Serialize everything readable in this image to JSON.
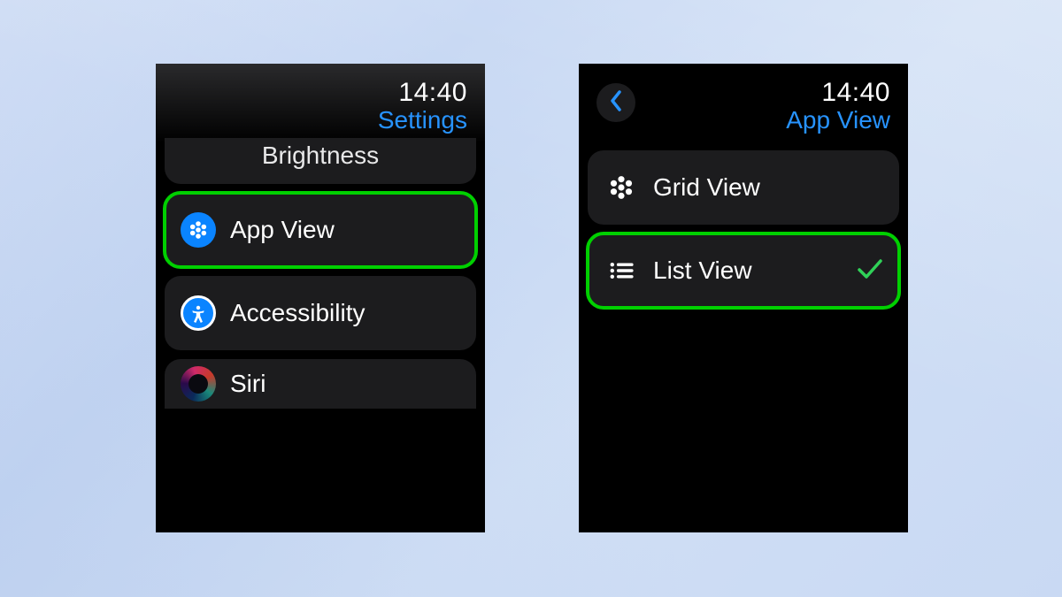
{
  "left": {
    "time": "14:40",
    "title": "Settings",
    "partial_top_label": "Brightness",
    "items": [
      {
        "label": "App View",
        "icon": "appview-icon",
        "highlighted": true
      },
      {
        "label": "Accessibility",
        "icon": "accessibility-icon",
        "highlighted": false
      },
      {
        "label": "Siri",
        "icon": "siri-icon",
        "highlighted": false
      }
    ]
  },
  "right": {
    "time": "14:40",
    "title": "App View",
    "items": [
      {
        "label": "Grid View",
        "icon": "grid-icon",
        "checked": false,
        "highlighted": false
      },
      {
        "label": "List View",
        "icon": "list-icon",
        "checked": true,
        "highlighted": true
      }
    ]
  },
  "colors": {
    "accent_blue": "#2793ff",
    "highlight_green": "#00d000",
    "check_green": "#30d158",
    "row_bg": "#1c1c1e"
  }
}
